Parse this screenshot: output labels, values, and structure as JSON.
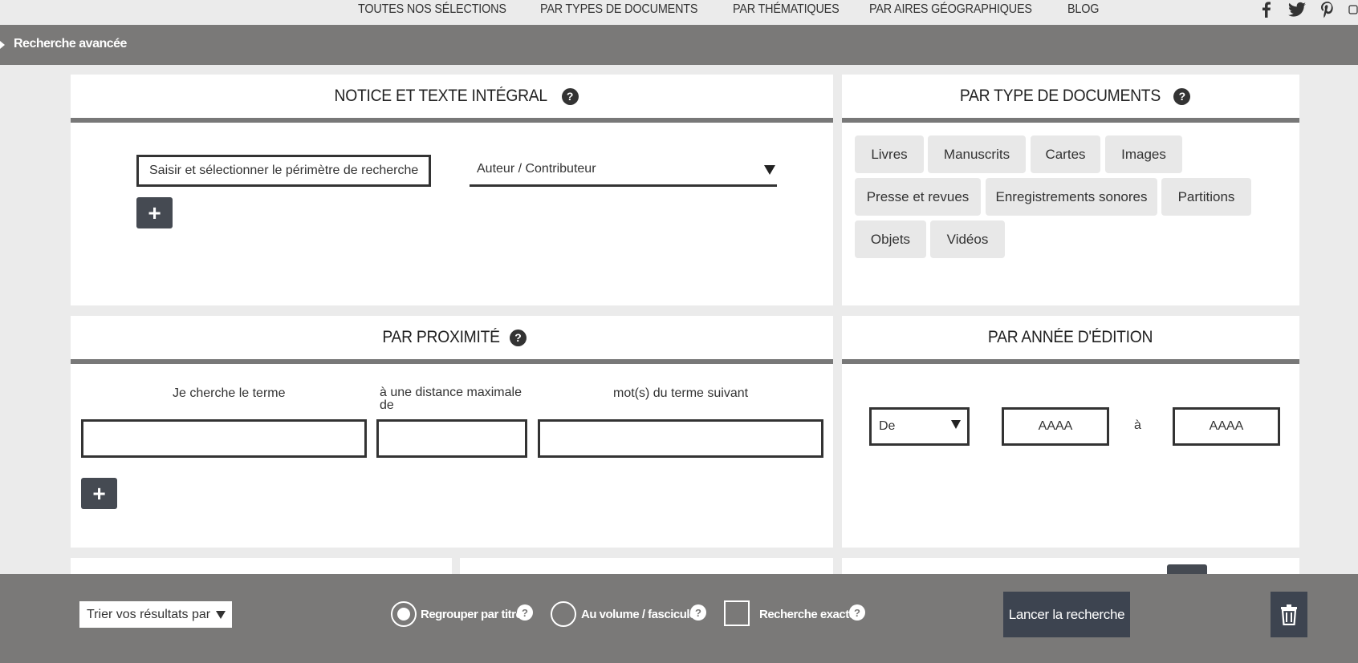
{
  "nav": {
    "links": [
      "TOUTES NOS SÉLECTIONS",
      "PAR TYPES DE DOCUMENTS",
      "PAR THÉMATIQUES",
      "PAR AIRES GÉOGRAPHIQUES",
      "BLOG"
    ],
    "social_icons": [
      "facebook-icon",
      "twitter-icon",
      "pinterest-icon",
      "instagram-icon"
    ]
  },
  "breadcrumb": {
    "label": "Recherche avancée"
  },
  "notice": {
    "title": "NOTICE ET TEXTE INTÉGRAL",
    "scope_placeholder": "Saisir et sélectionner le périmètre de recherche",
    "field_select": "Auteur / Contributeur",
    "add_label": "+"
  },
  "doctypes": {
    "title": "PAR TYPE DE DOCUMENTS",
    "buttons": [
      "Livres",
      "Manuscrits",
      "Cartes",
      "Images",
      "Presse et revues",
      "Enregistrements sonores",
      "Partitions",
      "Objets",
      "Vidéos"
    ]
  },
  "proximity": {
    "title": "PAR PROXIMITÉ",
    "label_term": "Je cherche le terme",
    "label_distance": "à une distance maximale de",
    "label_next": "mot(s) du terme suivant",
    "add_label": "+"
  },
  "year": {
    "title": "PAR ANNÉE D'ÉDITION",
    "mode_select": "De",
    "from_placeholder": "AAAA",
    "separator": "à",
    "to_placeholder": "AAAA"
  },
  "bottom": {
    "sort_label": "Trier vos résultats par",
    "group_title": "Regrouper par titre",
    "by_volume": "Au volume / fascicule",
    "exact": "Recherche exacte",
    "help": "?",
    "launch": "Lancer la recherche"
  }
}
